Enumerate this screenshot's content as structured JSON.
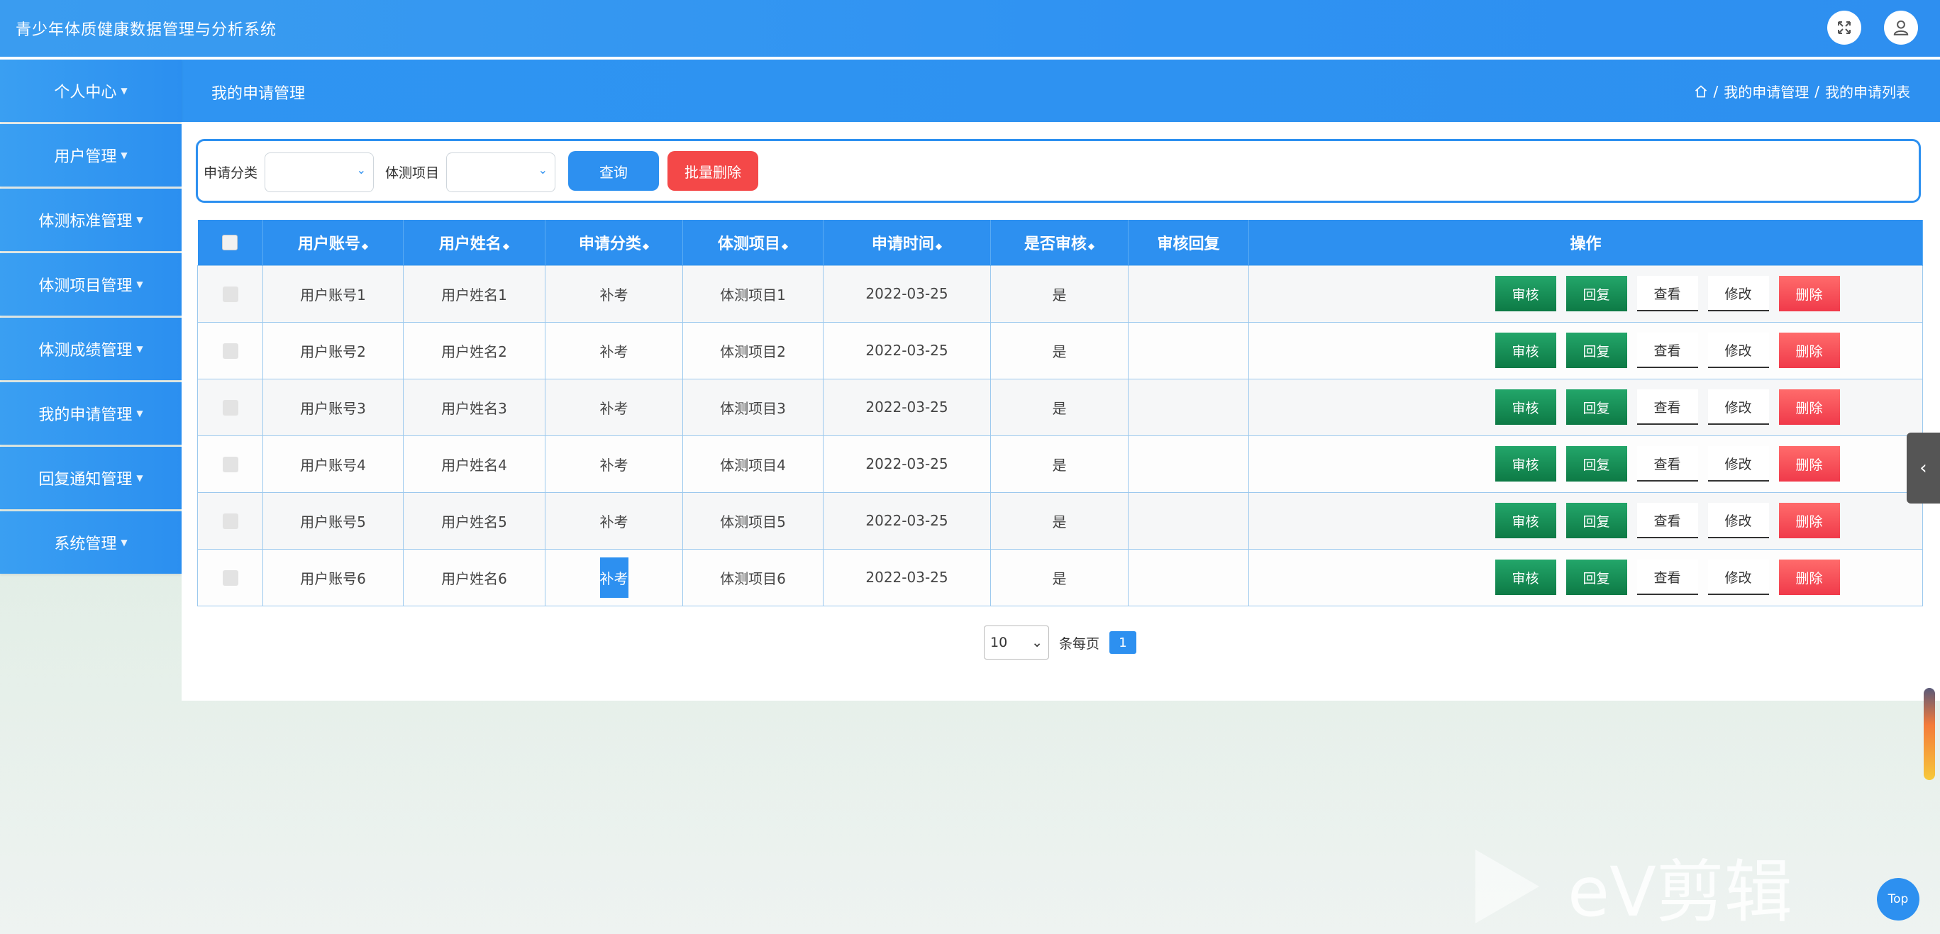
{
  "app": {
    "title": "青少年体质健康数据管理与分析系统"
  },
  "header": {
    "page_title": "我的申请管理"
  },
  "breadcrumb": {
    "items": [
      "我的申请管理",
      "我的申请列表"
    ],
    "sep": "/"
  },
  "sidebar": {
    "items": [
      {
        "label": "个人中心"
      },
      {
        "label": "用户管理"
      },
      {
        "label": "体测标准管理"
      },
      {
        "label": "体测项目管理"
      },
      {
        "label": "体测成绩管理"
      },
      {
        "label": "我的申请管理"
      },
      {
        "label": "回复通知管理"
      },
      {
        "label": "系统管理"
      }
    ]
  },
  "search": {
    "category_label": "申请分类",
    "project_label": "体测项目",
    "query_button": "查询",
    "batch_delete_button": "批量删除"
  },
  "table": {
    "headers": [
      "用户账号",
      "用户姓名",
      "申请分类",
      "体测项目",
      "申请时间",
      "是否审核",
      "审核回复",
      "操作"
    ],
    "rows": [
      {
        "account": "用户账号1",
        "name": "用户姓名1",
        "category": "补考",
        "project": "体测项目1",
        "time": "2022-03-25",
        "reviewed": "是",
        "reply": ""
      },
      {
        "account": "用户账号2",
        "name": "用户姓名2",
        "category": "补考",
        "project": "体测项目2",
        "time": "2022-03-25",
        "reviewed": "是",
        "reply": ""
      },
      {
        "account": "用户账号3",
        "name": "用户姓名3",
        "category": "补考",
        "project": "体测项目3",
        "time": "2022-03-25",
        "reviewed": "是",
        "reply": ""
      },
      {
        "account": "用户账号4",
        "name": "用户姓名4",
        "category": "补考",
        "project": "体测项目4",
        "time": "2022-03-25",
        "reviewed": "是",
        "reply": ""
      },
      {
        "account": "用户账号5",
        "name": "用户姓名5",
        "category": "补考",
        "project": "体测项目5",
        "time": "2022-03-25",
        "reviewed": "是",
        "reply": ""
      },
      {
        "account": "用户账号6",
        "name": "用户姓名6",
        "category": "补考",
        "project": "体测项目6",
        "time": "2022-03-25",
        "reviewed": "是",
        "reply": ""
      }
    ],
    "actions": {
      "review": "审核",
      "reply": "回复",
      "view": "查看",
      "edit": "修改",
      "delete": "删除"
    }
  },
  "pagination": {
    "page_size": "10",
    "per_page_label": "条每页",
    "current_page": "1"
  },
  "top_button": "Top",
  "watermark": "eV剪辑",
  "colors": {
    "primary": "#2d90f0",
    "danger": "#f44848",
    "success": "#1a9158"
  }
}
